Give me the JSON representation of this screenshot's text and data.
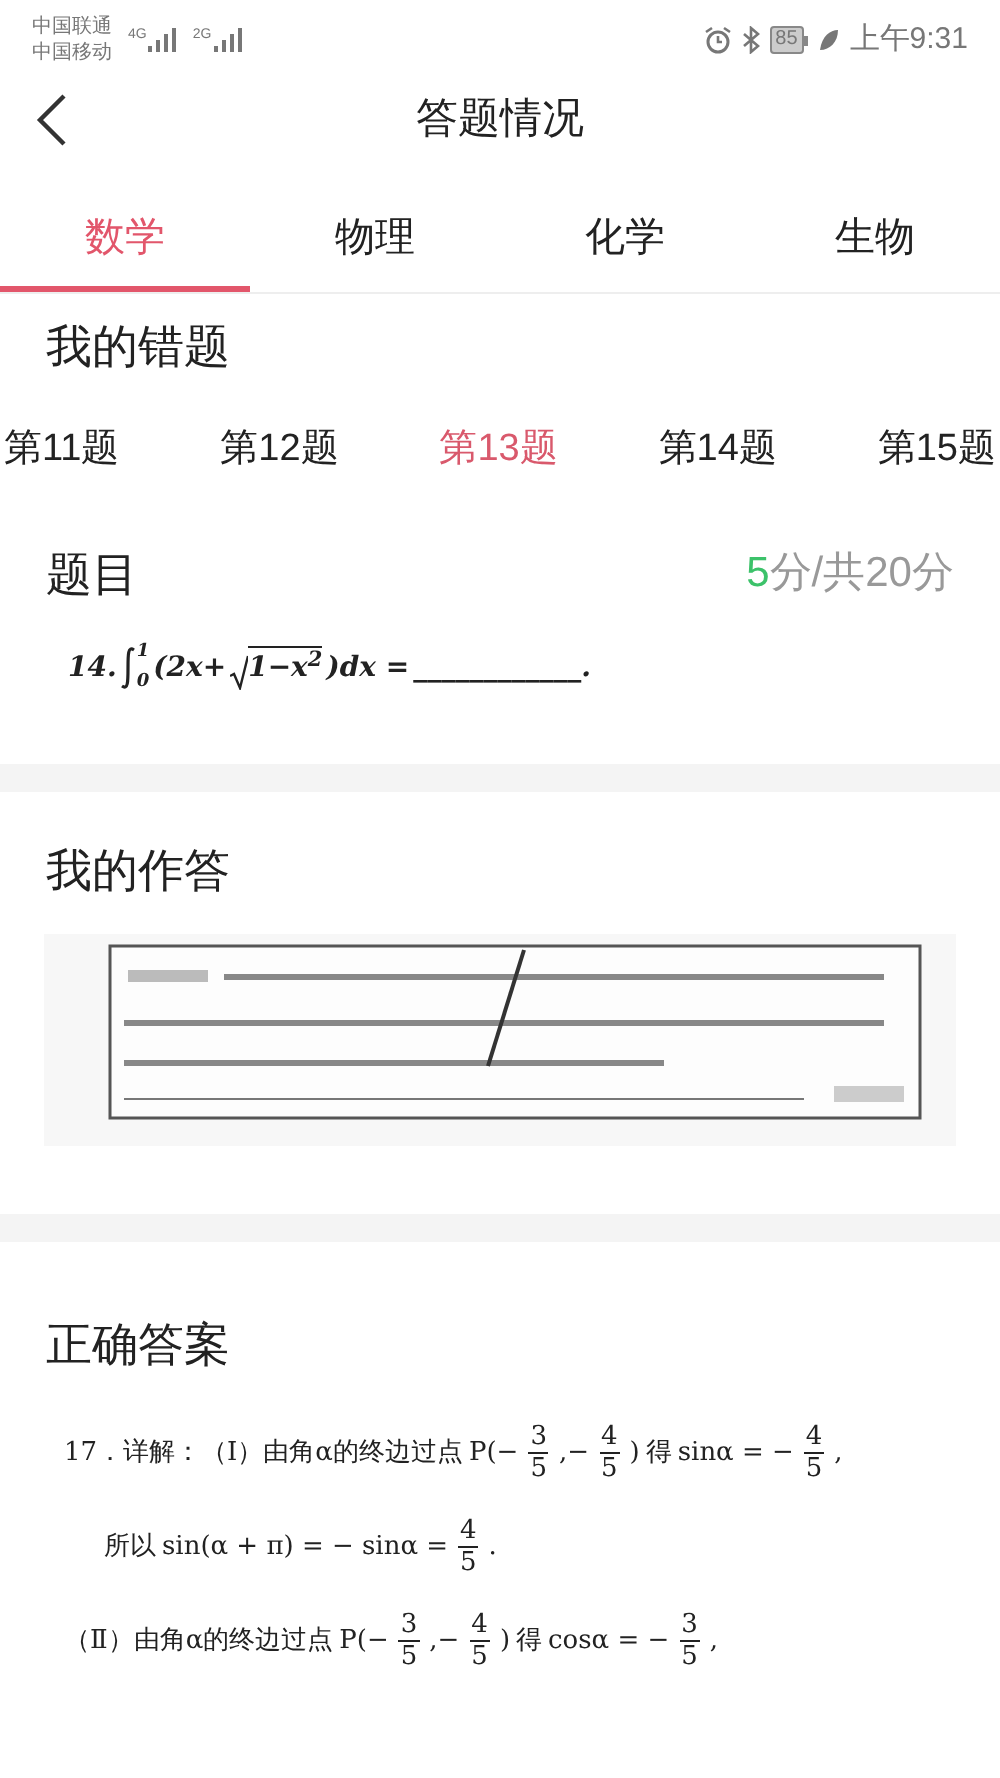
{
  "status_bar": {
    "carriers": [
      "中国联通",
      "中国移动"
    ],
    "networks": [
      "4G",
      "2G"
    ],
    "battery": "85",
    "time": "上午9:31"
  },
  "header": {
    "title": "答题情况"
  },
  "tabs": [
    {
      "label": "数学",
      "selected": true
    },
    {
      "label": "物理",
      "selected": false
    },
    {
      "label": "化学",
      "selected": false
    },
    {
      "label": "生物",
      "selected": false
    }
  ],
  "wrong_section": {
    "title": "我的错题"
  },
  "questions": [
    {
      "label": "第11题",
      "selected": false
    },
    {
      "label": "第12题",
      "selected": false
    },
    {
      "label": "第13题",
      "selected": true
    },
    {
      "label": "第14题",
      "selected": false
    },
    {
      "label": "第15题",
      "selected": false
    }
  ],
  "question": {
    "title": "题目",
    "score": "5",
    "score_rest": "分/共20分",
    "content": [
      {
        "kind": "text",
        "text": "14."
      },
      {
        "kind": "integral",
        "lower": "0",
        "upper": "1"
      },
      {
        "kind": "text",
        "text": "(2x+"
      },
      {
        "kind": "sqrt",
        "text": "1−x$^{2}$"
      },
      {
        "kind": "text",
        "text": ")dx ="
      },
      {
        "kind": "text",
        "text": "____________."
      }
    ]
  },
  "my_answer": {
    "title": "我的作答"
  },
  "correct_answer": {
    "title": "正确答案",
    "lines": [
      [
        {
          "kind": "text",
          "text": "17．详解：（Ⅰ）由角α的终边过点"
        },
        {
          "kind": "text",
          "text": "P(−"
        },
        {
          "kind": "frac",
          "num": "3",
          "den": "5"
        },
        {
          "kind": "text",
          "text": ",−"
        },
        {
          "kind": "frac",
          "num": "4",
          "den": "5"
        },
        {
          "kind": "text",
          "text": ")"
        },
        {
          "kind": "text",
          "text": "得"
        },
        {
          "kind": "text",
          "text": "sinα = −"
        },
        {
          "kind": "frac",
          "num": "4",
          "den": "5"
        },
        {
          "kind": "text",
          "text": ","
        }
      ],
      [
        {
          "kind": "text",
          "text": "所以"
        },
        {
          "kind": "text",
          "text": "sin(α + π) = − sinα ="
        },
        {
          "kind": "frac",
          "num": "4",
          "den": "5"
        },
        {
          "kind": "text",
          "text": "."
        }
      ],
      [
        {
          "kind": "text",
          "text": "（Ⅱ）由角α的终边过点"
        },
        {
          "kind": "text",
          "text": "P(−"
        },
        {
          "kind": "frac",
          "num": "3",
          "den": "5"
        },
        {
          "kind": "text",
          "text": ",−"
        },
        {
          "kind": "frac",
          "num": "4",
          "den": "5"
        },
        {
          "kind": "text",
          "text": ")"
        },
        {
          "kind": "text",
          "text": "得"
        },
        {
          "kind": "text",
          "text": "cosα = −"
        },
        {
          "kind": "frac",
          "num": "3",
          "den": "5"
        },
        {
          "kind": "text",
          "text": ","
        }
      ]
    ]
  }
}
